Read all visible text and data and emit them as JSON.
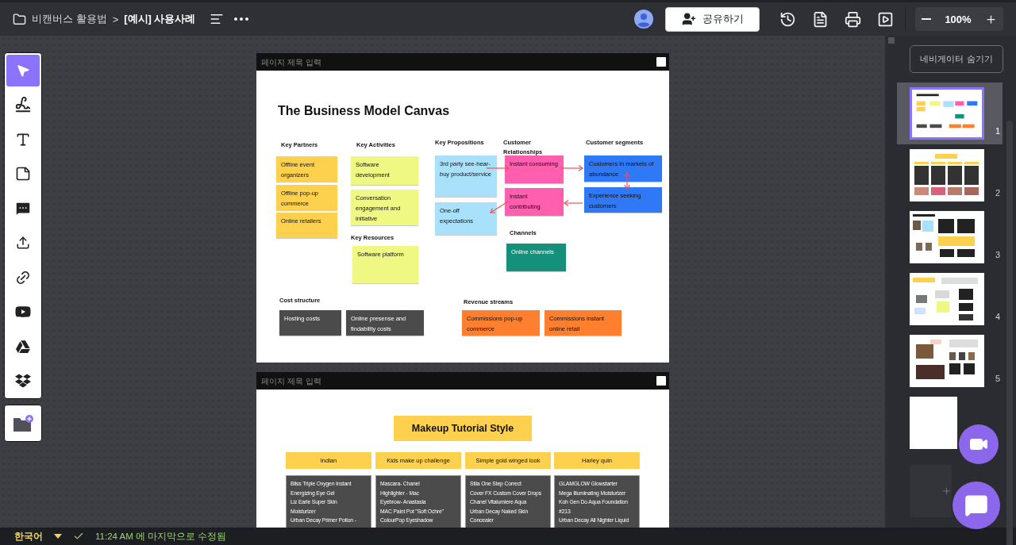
{
  "breadcrumb": {
    "folder": "비캔버스 활용법",
    "separator": ">",
    "title": "[예시] 사용사례"
  },
  "share_button": "공유하기",
  "zoom": {
    "value": "100%"
  },
  "tools": [
    {
      "kind": "select",
      "selected": true
    },
    {
      "kind": "draw",
      "selected": false
    },
    {
      "kind": "text",
      "selected": false
    },
    {
      "kind": "note",
      "selected": false
    },
    {
      "kind": "comment",
      "selected": false
    },
    {
      "kind": "upload",
      "selected": false
    },
    {
      "kind": "link",
      "selected": false
    },
    {
      "kind": "youtube",
      "selected": false
    },
    {
      "kind": "drive",
      "selected": false
    },
    {
      "kind": "dropbox",
      "selected": false
    }
  ],
  "pages": [
    {
      "kind": "canvas",
      "title_placeholder": "페이지 제목 입력",
      "checked": false,
      "title": "The Business Model Canvas",
      "labels": [
        "Key Partners",
        "Key Activities",
        "Key Propositions",
        "Customer Relationships",
        "Customer segments",
        "Key Resources",
        "Channels",
        "Cost structure",
        "Revenue streams"
      ],
      "notes": [
        {
          "text": "Offline event organizers",
          "color": "#fdd14d"
        },
        {
          "text": "Offline pop-up commerce",
          "color": "#fdd14d"
        },
        {
          "text": "Online retailers",
          "color": "#fdd14d"
        },
        {
          "text": "Software development",
          "color": "#eef883"
        },
        {
          "text": "Conversation engagement and initiative",
          "color": "#eef883"
        },
        {
          "text": "Software platform",
          "color": "#eef883"
        },
        {
          "text": "3rd party see-hear-buy product/service",
          "color": "#a9e1fb"
        },
        {
          "text": "One-off expectations",
          "color": "#a9e1fb"
        },
        {
          "text": "Instant consuming",
          "color": "#ff5fae"
        },
        {
          "text": "Instant contributing",
          "color": "#ff5fae"
        },
        {
          "text": "Customers in markets of abundance",
          "color": "#2f78f6"
        },
        {
          "text": "Experience seeking customers",
          "color": "#2f78f6"
        },
        {
          "text": "Online channels",
          "color": "#15907a"
        },
        {
          "text": "Hosting costs",
          "color": "#4b4b4b"
        },
        {
          "text": "Online presense and findability costs",
          "color": "#4b4b4b"
        },
        {
          "text": "Commissions pop-up commerce",
          "color": "#fe7f2e"
        },
        {
          "text": "Commissions instant online retail",
          "color": "#fe7f2e"
        }
      ]
    },
    {
      "kind": "columns",
      "title_placeholder": "페이지 제목 입력",
      "checked": false,
      "title": "Makeup Tutorial Style",
      "columns": [
        {
          "heading": "Indian",
          "lines": [
            "Bliss Triple Oxygen Instant",
            "Energizing Eye Gel",
            "Liz Earle Super Skin",
            "Moisturizer",
            "Urban Decay Primer Potion -"
          ]
        },
        {
          "heading": "Kids make up challenge",
          "lines": [
            "Mascara- Chanel",
            "Highlighter - Mac",
            "Eyebrow- Anastasia",
            "MAC Paint Pot \"Soft Ochre\"",
            "ColourPop Eyeshadow"
          ]
        },
        {
          "heading": "Simple gold winged look",
          "lines": [
            "Stila One Step Correct",
            "Cover FX Custom Cover Drops",
            "Chanel Vitalumiere Aqua",
            "Urban Decay Naked Skin",
            "Concealer"
          ]
        },
        {
          "heading": "Harley quin",
          "lines": [
            "GLAMGLOW Glowstarter",
            "Mega Illuminating Moisturizer",
            "Koh Gen Do Aqua Foundation",
            "#213",
            "Urban Decay All Nighter Liquid"
          ]
        }
      ]
    }
  ],
  "navigator": {
    "hide_button": "네비게이터 숨기기",
    "pages": [
      {
        "number": "1",
        "kind": "canvas",
        "selected": true
      },
      {
        "number": "2",
        "kind": "columns",
        "selected": false
      },
      {
        "number": "3",
        "kind": "mixed",
        "selected": false
      },
      {
        "number": "4",
        "kind": "notes",
        "selected": false
      },
      {
        "number": "5",
        "kind": "media",
        "selected": false
      },
      {
        "kind": "blank",
        "selected": false
      }
    ]
  },
  "status_bar": {
    "language": "한국어",
    "saved": "11:24 AM 에 마지막으로 수정됨"
  }
}
